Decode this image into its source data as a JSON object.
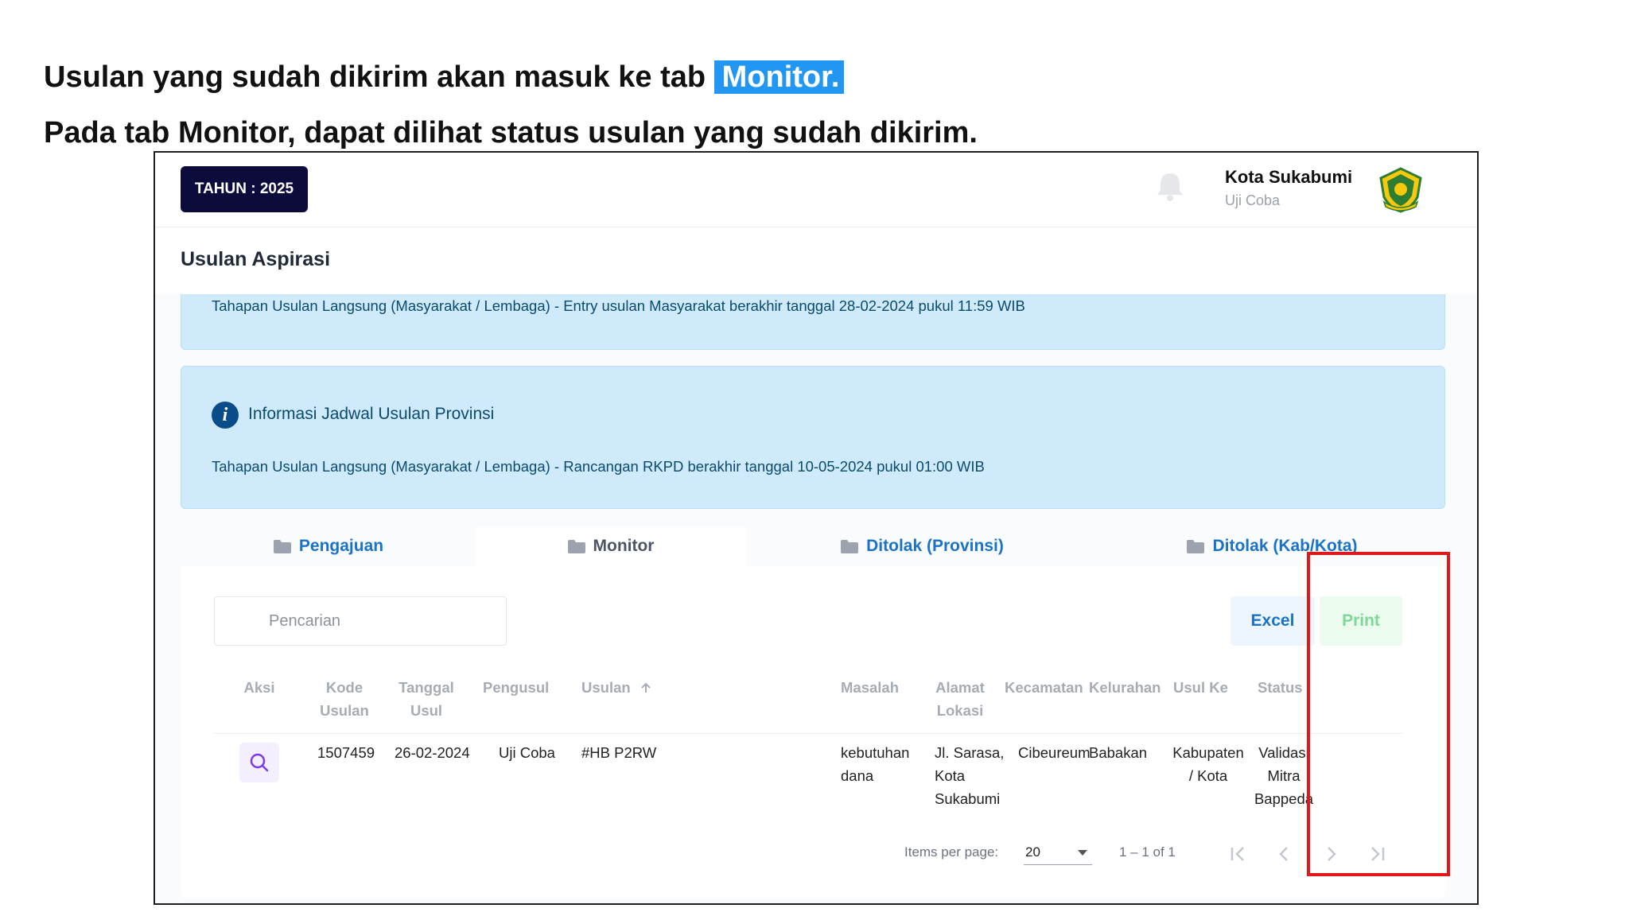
{
  "instructions": {
    "line1_text": "Usulan yang sudah dikirim akan masuk ke tab ",
    "line1_highlight": "Monitor.",
    "line2_text": "Pada tab Monitor, dapat dilihat status usulan yang sudah dikirim."
  },
  "header": {
    "year_label": "TAHUN : 2025",
    "user_name": "Kota Sukabumi",
    "user_sub": "Uji Coba"
  },
  "page": {
    "title": "Usulan Aspirasi"
  },
  "notices": {
    "first_text": "Tahapan Usulan Langsung (Masyarakat / Lembaga) - Entry usulan Masyarakat berakhir tanggal 28-02-2024 pukul 11:59 WIB",
    "second_title": "Informasi Jadwal Usulan Provinsi",
    "second_text": "Tahapan Usulan Langsung (Masyarakat / Lembaga) - Rancangan RKPD berakhir tanggal 10-05-2024 pukul 01:00 WIB"
  },
  "tabs": [
    {
      "label": "Pengajuan"
    },
    {
      "label": "Monitor"
    },
    {
      "label": "Ditolak (Provinsi)"
    },
    {
      "label": "Ditolak (Kab/Kota)"
    }
  ],
  "toolbar": {
    "search_placeholder": "Pencarian",
    "excel_label": "Excel",
    "print_label": "Print"
  },
  "table": {
    "headers": {
      "aksi": "Aksi",
      "kode_usulan_1": "Kode",
      "kode_usulan_2": "Usulan",
      "tanggal_usul_1": "Tanggal",
      "tanggal_usul_2": "Usul",
      "pengusul": "Pengusul",
      "usulan": "Usulan",
      "masalah": "Masalah",
      "alamat_lokasi_1": "Alamat",
      "alamat_lokasi_2": "Lokasi",
      "kecamatan": "Kecamatan",
      "kelurahan": "Kelurahan",
      "usul_ke": "Usul Ke",
      "status": "Status"
    },
    "rows": [
      {
        "kode_usulan": "1507459",
        "tanggal_usul": "26-02-2024",
        "pengusul": "Uji Coba",
        "usulan": "#HB P2RW",
        "masalah_1": "kebutuhan",
        "masalah_2": "dana",
        "alamat_1": "Jl. Sarasa,",
        "alamat_2": "Kota",
        "alamat_3": "Sukabumi",
        "kecamatan": "Cibeureum",
        "kelurahan": "Babakan",
        "usul_ke_1": "Kabupaten",
        "usul_ke_2": "/ Kota",
        "status_1": "Validasi",
        "status_2": "Mitra",
        "status_3": "Bappeda"
      }
    ]
  },
  "pagination": {
    "items_per_page_label": "Items per page:",
    "items_per_page_value": "20",
    "range_text": "1 – 1 of 1"
  },
  "icons": {
    "bell": "bell-icon",
    "emblem": "city-emblem-icon",
    "info": "info-icon",
    "folder": "folder-icon",
    "search": "search-icon",
    "first": "first-page-icon",
    "prev": "prev-page-icon",
    "next": "next-page-icon",
    "last": "last-page-icon"
  },
  "colors": {
    "highlight": "#2196f3",
    "year_badge": "#0c0b3b",
    "notice_bg": "#cfeafb",
    "tab_link": "#1a73c8",
    "annotation_red": "#e01818"
  }
}
